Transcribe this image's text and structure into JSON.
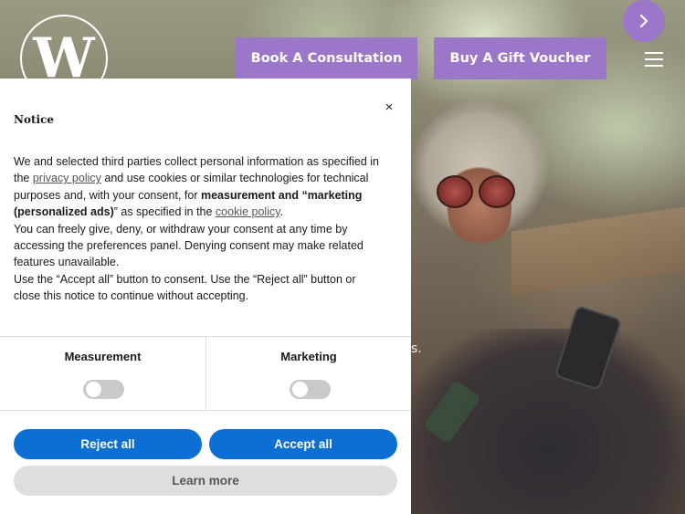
{
  "header": {
    "logo_letter": "W",
    "consult_label": "Book A Consultation",
    "gift_label": "Buy A Gift Voucher",
    "menu_icon": "hamburger-menu-icon",
    "next_icon": "chevron-right-icon"
  },
  "hero": {
    "visible_text": "s."
  },
  "notice": {
    "title": "Notice",
    "close_glyph": "×",
    "body": {
      "p1_a": "We and selected third parties collect personal information as specified in the ",
      "privacy_link": "privacy policy",
      "p1_b": " and use cookies or similar technologies for technical purposes and, with your consent, for ",
      "p1_bold1": "measurement and “marketing (personalized ads)",
      "p1_c": "” as specified in the ",
      "cookie_link": "cookie policy",
      "p1_d": ".",
      "p2": "You can freely give, deny, or withdraw your consent at any time by accessing the preferences panel. Denying consent may make related features unavailable.",
      "p3": "Use the “Accept all” button to consent. Use the “Reject all” button or close this notice to continue without accepting."
    },
    "prefs": [
      {
        "label": "Measurement",
        "enabled": false
      },
      {
        "label": "Marketing",
        "enabled": false
      }
    ],
    "reject_label": "Reject all",
    "accept_label": "Accept all",
    "learn_label": "Learn more"
  },
  "colors": {
    "accent_purple": "#9c76c9",
    "consent_blue": "#0c6fd4",
    "learn_gray": "#dedede"
  }
}
